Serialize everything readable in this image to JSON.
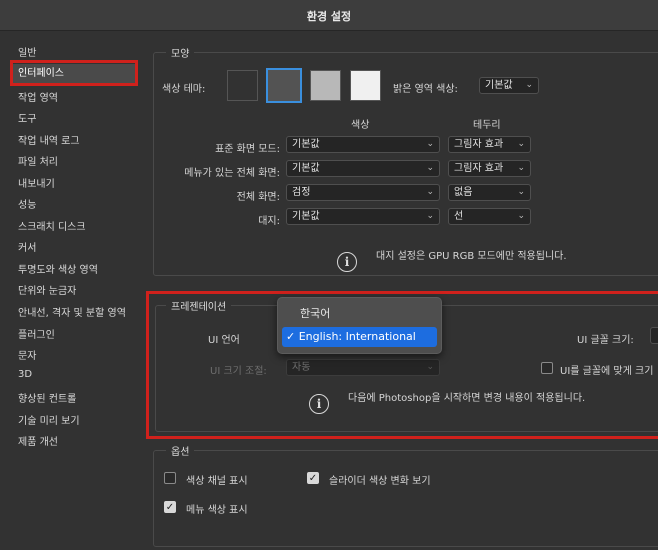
{
  "window": {
    "title": "환경 설정"
  },
  "sidebar": {
    "items": [
      {
        "label": "일반"
      },
      {
        "label": "인터페이스"
      },
      {
        "label": "작업 영역"
      },
      {
        "label": "도구"
      },
      {
        "label": "작업 내역 로그"
      },
      {
        "label": "파일 처리"
      },
      {
        "label": "내보내기"
      },
      {
        "label": "성능"
      },
      {
        "label": "스크래치 디스크"
      },
      {
        "label": "커서"
      },
      {
        "label": "투명도와 색상 영역"
      },
      {
        "label": "단위와 눈금자"
      },
      {
        "label": "안내선, 격자 및 분할 영역"
      },
      {
        "label": "플러그인"
      },
      {
        "label": "문자"
      },
      {
        "label": "3D"
      },
      {
        "label": "향상된 컨트롤"
      },
      {
        "label": "기술 미리 보기"
      },
      {
        "label": "제품 개선"
      }
    ],
    "selected_index": 1
  },
  "appearance": {
    "title": "모양",
    "color_theme_label": "색상 테마:",
    "theme_colors": [
      "#323232",
      "#535353",
      "#b8b8b8",
      "#f0f0f0"
    ],
    "selected_theme_index": 1,
    "highlight_label": "밝은 영역 색상:",
    "highlight_value": "기본값",
    "col_color": "색상",
    "col_border": "테두리",
    "rows": [
      {
        "label": "표준 화면 모드:",
        "color": "기본값",
        "border": "그림자 효과"
      },
      {
        "label": "메뉴가 있는 전체 화면:",
        "color": "기본값",
        "border": "그림자 효과"
      },
      {
        "label": "전체 화면:",
        "color": "검정",
        "border": "없음"
      },
      {
        "label": "대지:",
        "color": "기본값",
        "border": "선"
      }
    ],
    "info": "대지 설정은 GPU RGB 모드에만 적용됩니다."
  },
  "presentation": {
    "title": "프레젠테이션",
    "ui_language_label": "UI 언어",
    "ui_font_size_label": "UI 글꼴 크기:",
    "ui_scale_label": "UI 크기 조절:",
    "ui_scale_value": "자동",
    "scale_to_font_label": "UI를 글꼴에 맞게 크기",
    "info": "다음에 Photoshop을 시작하면 변경 내용이 적용됩니다.",
    "language_options": [
      {
        "label": "한국어",
        "checked": false
      },
      {
        "label": "✓ English: International",
        "checked": true
      }
    ]
  },
  "options": {
    "title": "옵션",
    "show_channels_label": "색상 채널 표시",
    "show_channels_checked": false,
    "slider_label": "슬라이더 색상 변화 보기",
    "slider_checked": true,
    "menu_colors_label": "메뉴 색상 표시",
    "menu_colors_checked": true
  },
  "colors": {
    "accent": "#1d6de0",
    "annotation": "#d0211c"
  }
}
